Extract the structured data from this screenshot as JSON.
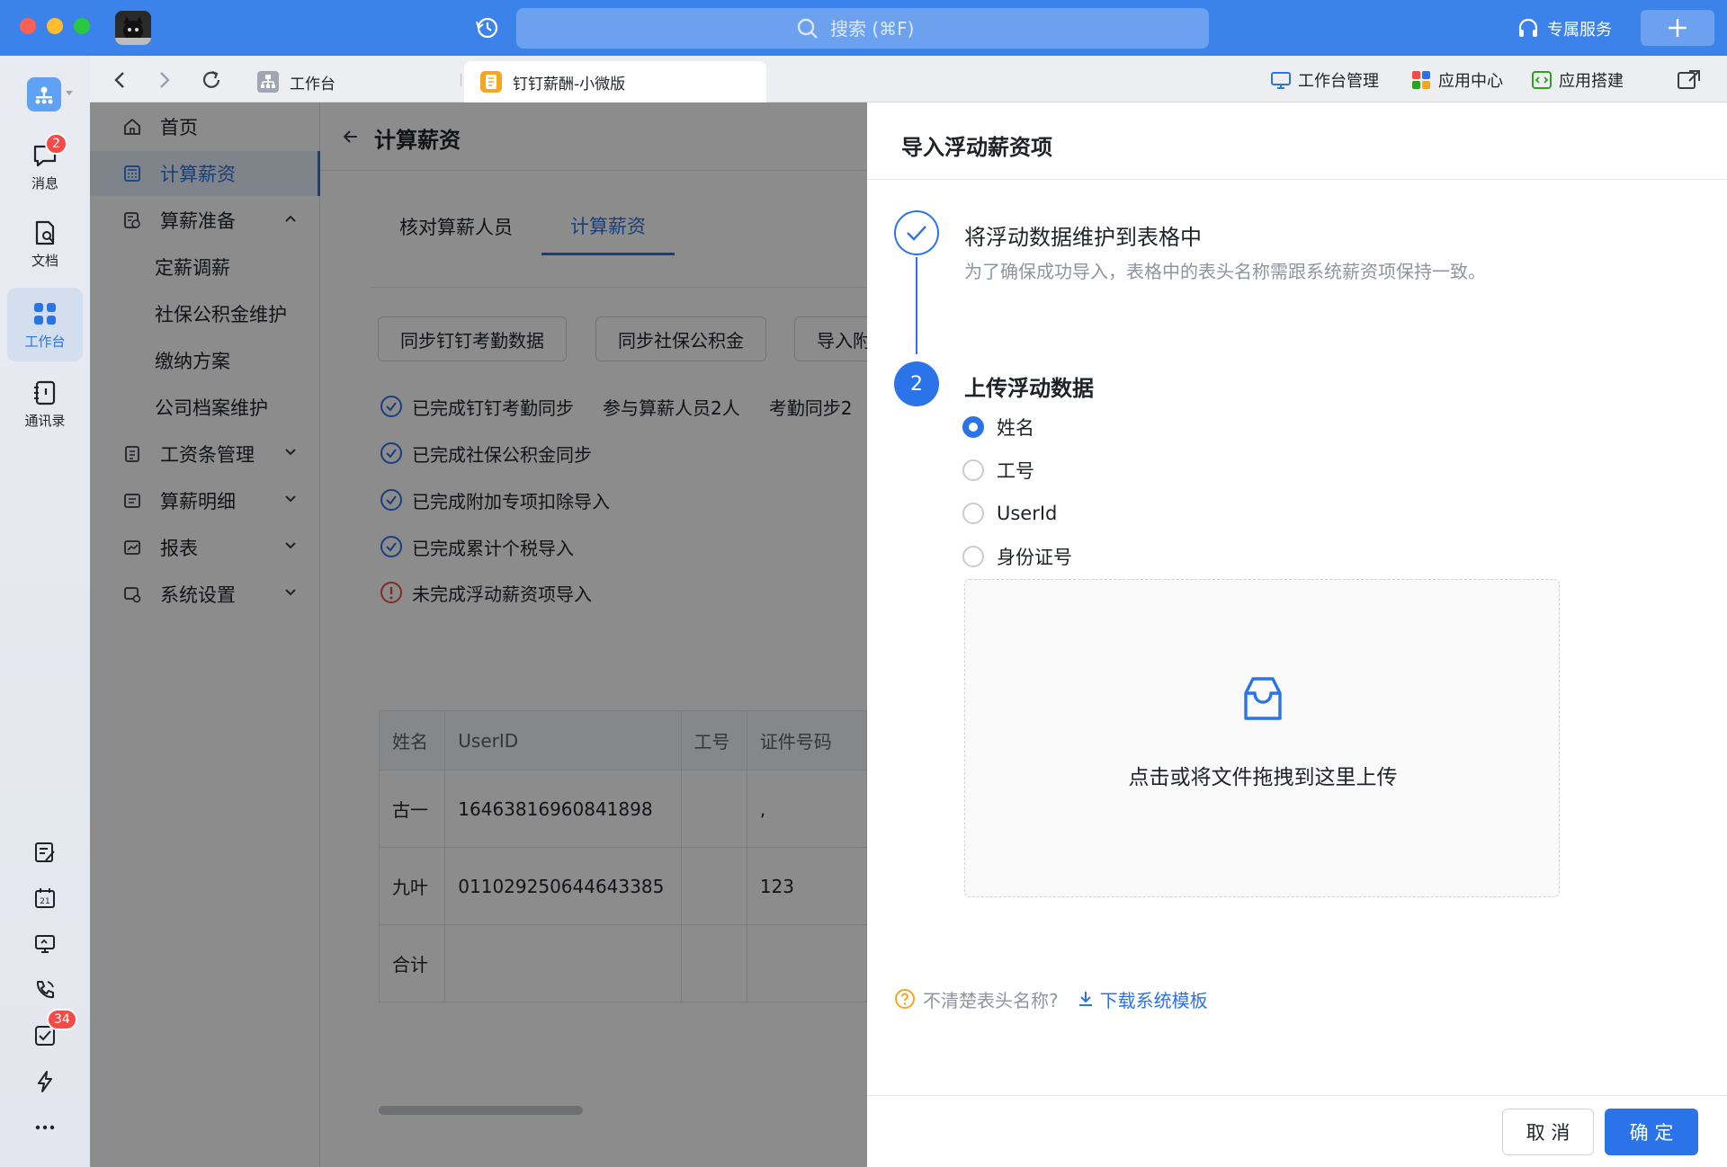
{
  "titlebar": {
    "search_placeholder": "搜索 (⌘F)",
    "service_label": "专属服务"
  },
  "rail": {
    "items": [
      {
        "label": "消息",
        "badge": "2"
      },
      {
        "label": "文档"
      },
      {
        "label": "工作台"
      },
      {
        "label": "通讯录"
      }
    ],
    "todo_badge": "34"
  },
  "tabs": {
    "items": [
      {
        "label": "工作台"
      },
      {
        "label": "钉钉薪酬-小微版"
      }
    ],
    "links": [
      {
        "label": "工作台管理"
      },
      {
        "label": "应用中心"
      },
      {
        "label": "应用搭建"
      }
    ]
  },
  "sidebar": {
    "items": [
      {
        "label": "首页"
      },
      {
        "label": "计算薪资"
      },
      {
        "label": "算薪准备"
      },
      {
        "label": "定薪调薪"
      },
      {
        "label": "社保公积金维护"
      },
      {
        "label": "缴纳方案"
      },
      {
        "label": "公司档案维护"
      },
      {
        "label": "工资条管理"
      },
      {
        "label": "算薪明细"
      },
      {
        "label": "报表"
      },
      {
        "label": "系统设置"
      }
    ]
  },
  "content": {
    "title": "计算薪资",
    "sub_tabs": [
      "核对算薪人员",
      "计算薪资"
    ],
    "actions": [
      "同步钉钉考勤数据",
      "同步社保公积金",
      "导入附"
    ],
    "status": [
      {
        "text": "已完成钉钉考勤同步",
        "extra1": "参与算薪人员2人",
        "extra2": "考勤同步2"
      },
      {
        "text": "已完成社保公积金同步"
      },
      {
        "text": "已完成附加专项扣除导入"
      },
      {
        "text": "已完成累计个税导入"
      },
      {
        "text": "未完成浮动薪资项导入"
      }
    ],
    "table": {
      "headers": [
        "姓名",
        "UserID",
        "工号",
        "证件号码"
      ],
      "rows": [
        [
          "古一",
          "16463816960841898",
          "",
          ","
        ],
        [
          "九叶",
          "011029250644643385",
          "",
          "123"
        ],
        [
          "合计",
          "",
          "",
          ""
        ]
      ]
    }
  },
  "drawer": {
    "title": "导入浮动薪资项",
    "step1": {
      "title": "将浮动数据维护到表格中",
      "desc": "为了确保成功导入，表格中的表头名称需跟系统薪资项保持一致。"
    },
    "step2": {
      "number": "2",
      "title": "上传浮动数据",
      "options": [
        "姓名",
        "工号",
        "UserId",
        "身份证号"
      ],
      "selected": "姓名"
    },
    "upload_text": "点击或将文件拖拽到这里上传",
    "help_text": "不清楚表头名称?",
    "download_label": "下载系统模板",
    "cancel_label": "取 消",
    "ok_label": "确 定"
  }
}
